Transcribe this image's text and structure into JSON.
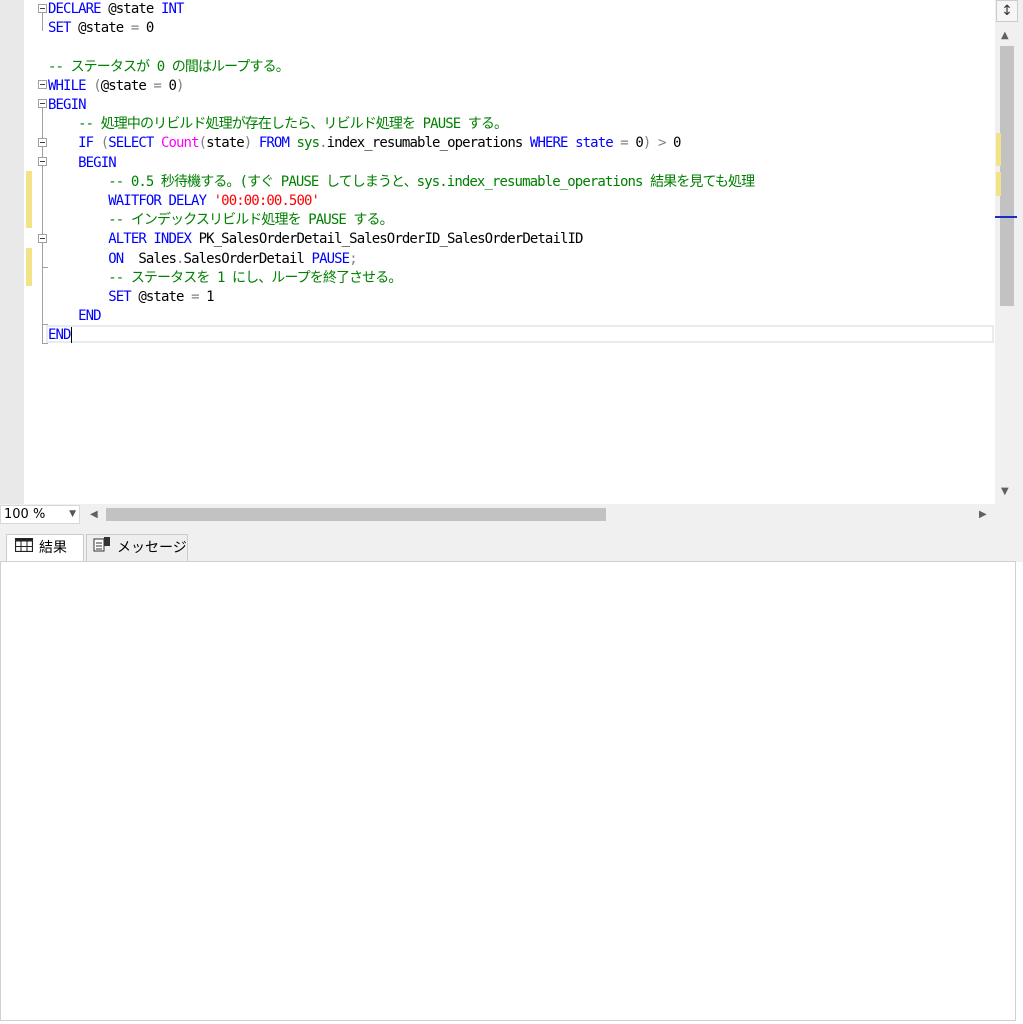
{
  "editor": {
    "lines": [
      [
        {
          "t": "DECLARE ",
          "c": "kw"
        },
        {
          "t": "@state ",
          "c": ""
        },
        {
          "t": "INT",
          "c": "kw"
        }
      ],
      [
        {
          "t": "SET ",
          "c": "kw"
        },
        {
          "t": "@state ",
          "c": ""
        },
        {
          "t": "= ",
          "c": "op"
        },
        {
          "t": "0",
          "c": ""
        }
      ],
      [],
      [
        {
          "t": "-- ステータスが 0 の間はループする。",
          "c": "cm"
        }
      ],
      [
        {
          "t": "WHILE ",
          "c": "kw"
        },
        {
          "t": "(",
          "c": "op"
        },
        {
          "t": "@state ",
          "c": ""
        },
        {
          "t": "= ",
          "c": "op"
        },
        {
          "t": "0",
          "c": ""
        },
        {
          "t": ")",
          "c": "op"
        }
      ],
      [
        {
          "t": "BEGIN",
          "c": "kw"
        }
      ],
      [
        {
          "t": "    ",
          "c": ""
        },
        {
          "t": "-- 処理中のリビルド処理が存在したら、リビルド処理を PAUSE する。",
          "c": "cm"
        }
      ],
      [
        {
          "t": "    ",
          "c": ""
        },
        {
          "t": "IF ",
          "c": "kw"
        },
        {
          "t": "(",
          "c": "op"
        },
        {
          "t": "SELECT ",
          "c": "kw"
        },
        {
          "t": "Count",
          "c": "fn"
        },
        {
          "t": "(",
          "c": "op"
        },
        {
          "t": "state",
          "c": ""
        },
        {
          "t": ") ",
          "c": "op"
        },
        {
          "t": "FROM ",
          "c": "kw"
        },
        {
          "t": "sys",
          "c": "sys"
        },
        {
          "t": ".",
          "c": "op"
        },
        {
          "t": "index_resumable_operations ",
          "c": ""
        },
        {
          "t": "WHERE ",
          "c": "kw"
        },
        {
          "t": "state ",
          "c": "kw"
        },
        {
          "t": "= ",
          "c": "op"
        },
        {
          "t": "0",
          "c": ""
        },
        {
          "t": ") ",
          "c": "op"
        },
        {
          "t": "> ",
          "c": "op"
        },
        {
          "t": "0",
          "c": ""
        }
      ],
      [
        {
          "t": "    ",
          "c": ""
        },
        {
          "t": "BEGIN",
          "c": "kw"
        }
      ],
      [
        {
          "t": "        ",
          "c": ""
        },
        {
          "t": "-- 0.5 秒待機する。(すぐ PAUSE してしまうと、sys.index_resumable_operations 結果を見ても処理",
          "c": "cm"
        }
      ],
      [
        {
          "t": "        ",
          "c": ""
        },
        {
          "t": "WAITFOR DELAY ",
          "c": "kw"
        },
        {
          "t": "'00:00:00.500'",
          "c": "str"
        }
      ],
      [
        {
          "t": "        ",
          "c": ""
        },
        {
          "t": "-- インデックスリビルド処理を PAUSE する。",
          "c": "cm"
        }
      ],
      [
        {
          "t": "        ",
          "c": ""
        },
        {
          "t": "ALTER INDEX ",
          "c": "kw"
        },
        {
          "t": "PK_SalesOrderDetail_SalesOrderID_SalesOrderDetailID",
          "c": ""
        }
      ],
      [
        {
          "t": "        ",
          "c": ""
        },
        {
          "t": "ON  ",
          "c": "kw"
        },
        {
          "t": "Sales",
          "c": ""
        },
        {
          "t": ".",
          "c": "op"
        },
        {
          "t": "SalesOrderDetail ",
          "c": ""
        },
        {
          "t": "PAUSE",
          "c": "kw"
        },
        {
          "t": ";",
          "c": "op"
        }
      ],
      [
        {
          "t": "        ",
          "c": ""
        },
        {
          "t": "-- ステータスを 1 にし、ループを終了させる。",
          "c": "cm"
        }
      ],
      [
        {
          "t": "        ",
          "c": ""
        },
        {
          "t": "SET ",
          "c": "kw"
        },
        {
          "t": "@state ",
          "c": ""
        },
        {
          "t": "= ",
          "c": "op"
        },
        {
          "t": "1",
          "c": ""
        }
      ],
      [
        {
          "t": "    ",
          "c": ""
        },
        {
          "t": "END",
          "c": "kw"
        }
      ],
      [
        {
          "t": "END",
          "c": "kw"
        }
      ]
    ]
  },
  "zoom": {
    "value": "100 %"
  },
  "tabs": {
    "results": "結果",
    "messages": "メッセージ"
  },
  "icons": {
    "split": "split-icon",
    "results": "grid-icon",
    "messages": "messages-icon"
  },
  "colors": {
    "keyword": "#0000ff",
    "function": "#ff00ff",
    "comment": "#008000",
    "string": "#ff0000",
    "operator": "#808080"
  }
}
